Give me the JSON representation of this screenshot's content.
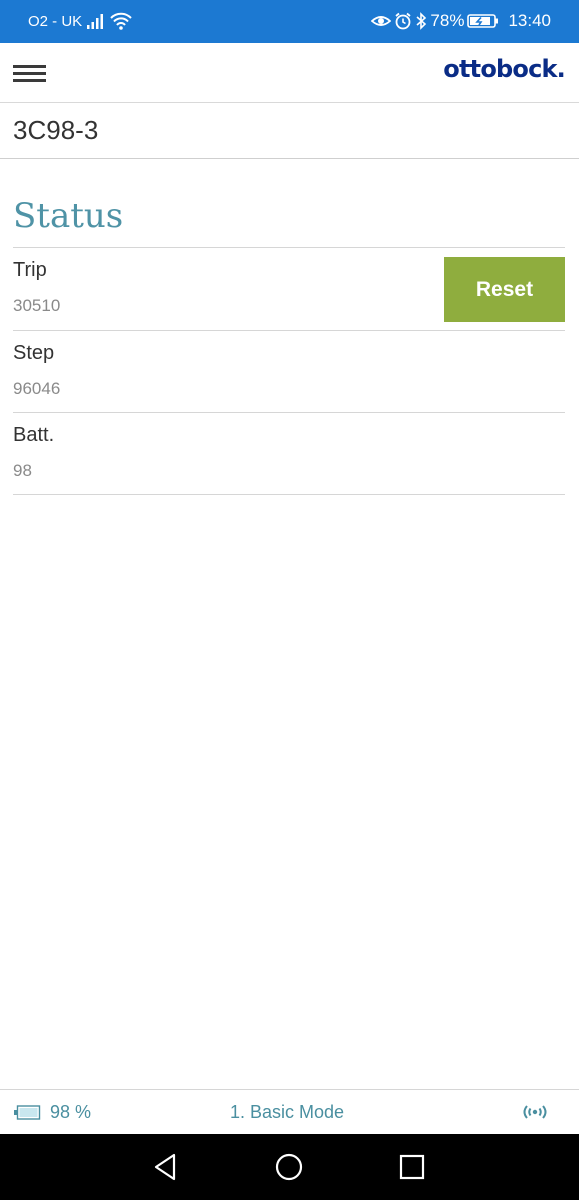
{
  "status_bar": {
    "carrier": "O2 - UK",
    "battery_percent": "78%",
    "time": "13:40"
  },
  "app_bar": {
    "logo": "ottobock."
  },
  "device": {
    "name": "3C98-3"
  },
  "status": {
    "title": "Status",
    "reset_label": "Reset",
    "items": [
      {
        "label": "Trip",
        "value": "30510"
      },
      {
        "label": "Step",
        "value": "96046"
      },
      {
        "label": "Batt.",
        "value": "98"
      }
    ]
  },
  "footer": {
    "battery": "98 %",
    "mode": "1. Basic Mode",
    "battery_icon": "battery-icon",
    "signal_icon": "bluetooth-signal-icon"
  },
  "colors": {
    "status_bar": "#1c79d2",
    "brand": "#0a2c86",
    "accent_teal": "#4f93a6",
    "reset_green": "#8fad3e"
  }
}
